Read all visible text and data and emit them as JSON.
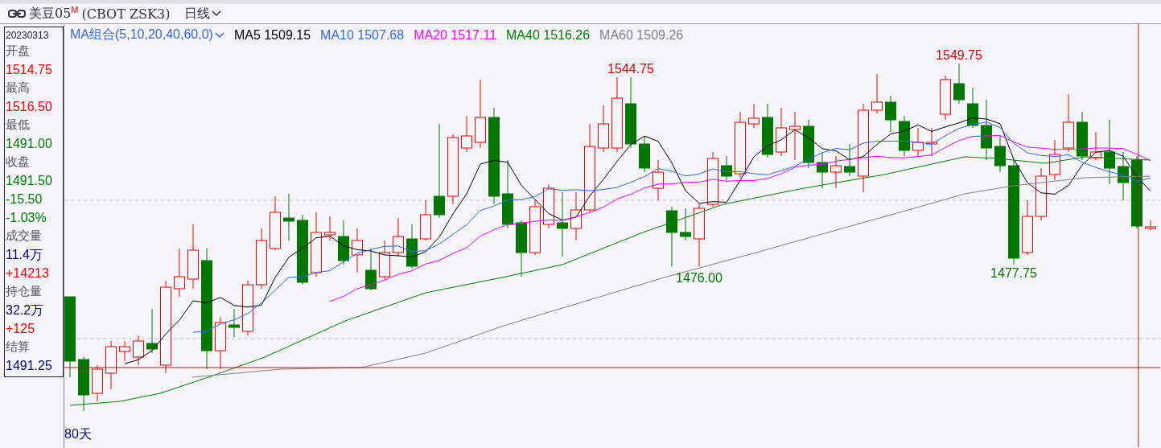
{
  "header": {
    "symbol": "美豆05",
    "superscript": "M",
    "code": "(CBOT  ZSK3)",
    "period": "日线"
  },
  "info_panel": {
    "date": "20230313",
    "rows": [
      {
        "text": "开盘",
        "kind": "label"
      },
      {
        "text": "1514.75",
        "kind": "value",
        "color": "#ff0000"
      },
      {
        "text": "最高",
        "kind": "label"
      },
      {
        "text": "1516.50",
        "kind": "value",
        "color": "#ff0000"
      },
      {
        "text": "最低",
        "kind": "label"
      },
      {
        "text": "1491.00",
        "kind": "value",
        "color": "#008000"
      },
      {
        "text": "收盘",
        "kind": "label"
      },
      {
        "text": "1491.50",
        "kind": "value",
        "color": "#008000"
      },
      {
        "text": "-15.50",
        "kind": "value",
        "color": "#008000"
      },
      {
        "text": "-1.03%",
        "kind": "value",
        "color": "#008000"
      },
      {
        "text": "成交量",
        "kind": "label"
      },
      {
        "text": "11.4万",
        "kind": "value",
        "color": "#000080"
      },
      {
        "text": "+14213",
        "kind": "value",
        "color": "#ff0000"
      },
      {
        "text": "持仓量",
        "kind": "label"
      },
      {
        "text": "32.2万",
        "kind": "value",
        "color": "#000080"
      },
      {
        "text": "+125",
        "kind": "value",
        "color": "#ff0000"
      },
      {
        "text": "结算",
        "kind": "label"
      },
      {
        "text": "1491.25",
        "kind": "value",
        "color": "#000080"
      }
    ]
  },
  "legend": {
    "selector": "MA组合(5,10,20,40,60,0)",
    "lines": [
      {
        "name": "MA5",
        "value": "1509.15",
        "color": "#000000"
      },
      {
        "name": "MA10",
        "value": "1507.68",
        "color": "#3366ff"
      },
      {
        "name": "MA20",
        "value": "1517.11",
        "color": "#ff00ff"
      },
      {
        "name": "MA40",
        "value": "1516.26",
        "color": "#008000"
      },
      {
        "name": "MA60",
        "value": "1509.26",
        "color": "#808080"
      }
    ]
  },
  "price_labels": [
    {
      "text": "1544.75",
      "kind": "high"
    },
    {
      "text": "1549.75",
      "kind": "high"
    },
    {
      "text": "1476.00",
      "kind": "low"
    },
    {
      "text": "1477.75",
      "kind": "low"
    }
  ],
  "footer": {
    "range": "80天"
  }
}
